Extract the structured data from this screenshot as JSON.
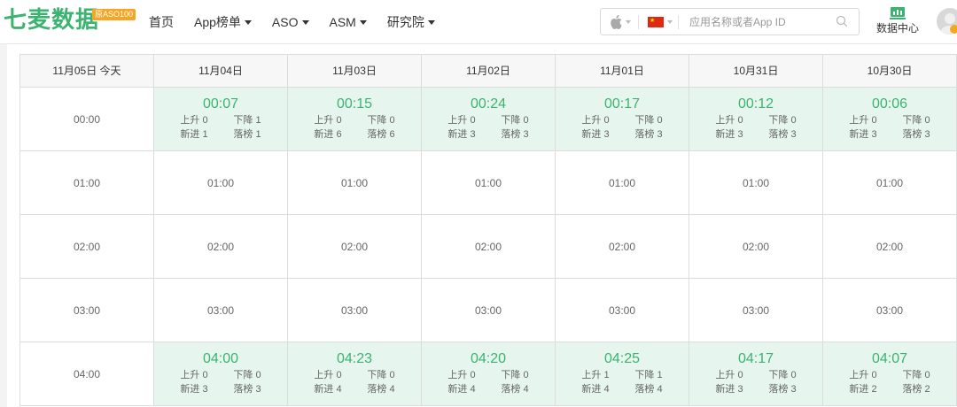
{
  "brand": {
    "name": "七麦数据",
    "badge": "原ASO100",
    "accent": "#3cb371"
  },
  "nav": [
    {
      "label": "首页",
      "dropdown": false
    },
    {
      "label": "App榜单",
      "dropdown": true
    },
    {
      "label": "ASO",
      "dropdown": true
    },
    {
      "label": "ASM",
      "dropdown": true
    },
    {
      "label": "研究院",
      "dropdown": true
    }
  ],
  "search": {
    "platform": "apple-icon",
    "country": "china-flag",
    "placeholder": "应用名称或者App ID"
  },
  "data_center": {
    "label": "数据中心"
  },
  "table": {
    "headers": [
      "11月05日 今天",
      "11月04日",
      "11月03日",
      "11月02日",
      "11月01日",
      "10月31日",
      "10月30日"
    ],
    "rows": [
      {
        "time": "00:00",
        "cells": [
          {
            "time": "00:07",
            "up": "上升 0",
            "down": "下降 1",
            "new": "新进 1",
            "drop": "落榜 1"
          },
          {
            "time": "00:15",
            "up": "上升 0",
            "down": "下降 0",
            "new": "新进 6",
            "drop": "落榜 6"
          },
          {
            "time": "00:24",
            "up": "上升 0",
            "down": "下降 0",
            "new": "新进 3",
            "drop": "落榜 3"
          },
          {
            "time": "00:17",
            "up": "上升 0",
            "down": "下降 0",
            "new": "新进 3",
            "drop": "落榜 3"
          },
          {
            "time": "00:12",
            "up": "上升 0",
            "down": "下降 0",
            "new": "新进 3",
            "drop": "落榜 3"
          },
          {
            "time": "00:06",
            "up": "上升 0",
            "down": "下降 0",
            "new": "新进 3",
            "drop": "落榜 3"
          }
        ]
      },
      {
        "time": "01:00",
        "cells": [
          "01:00",
          "01:00",
          "01:00",
          "01:00",
          "01:00",
          "01:00"
        ]
      },
      {
        "time": "02:00",
        "cells": [
          "02:00",
          "02:00",
          "02:00",
          "02:00",
          "02:00",
          "02:00"
        ]
      },
      {
        "time": "03:00",
        "cells": [
          "03:00",
          "03:00",
          "03:00",
          "03:00",
          "03:00",
          "03:00"
        ]
      },
      {
        "time": "04:00",
        "cells": [
          {
            "time": "04:00",
            "up": "上升 0",
            "down": "下降 0",
            "new": "新进 3",
            "drop": "落榜 3"
          },
          {
            "time": "04:23",
            "up": "上升 0",
            "down": "下降 0",
            "new": "新进 4",
            "drop": "落榜 4"
          },
          {
            "time": "04:20",
            "up": "上升 0",
            "down": "下降 0",
            "new": "新进 4",
            "drop": "落榜 4"
          },
          {
            "time": "04:25",
            "up": "上升 1",
            "down": "下降 1",
            "new": "新进 4",
            "drop": "落榜 4"
          },
          {
            "time": "04:17",
            "up": "上升 0",
            "down": "下降 0",
            "new": "新进 3",
            "drop": "落榜 3"
          },
          {
            "time": "04:07",
            "up": "上升 0",
            "down": "下降 0",
            "new": "新进 2",
            "drop": "落榜 2"
          }
        ]
      }
    ]
  }
}
